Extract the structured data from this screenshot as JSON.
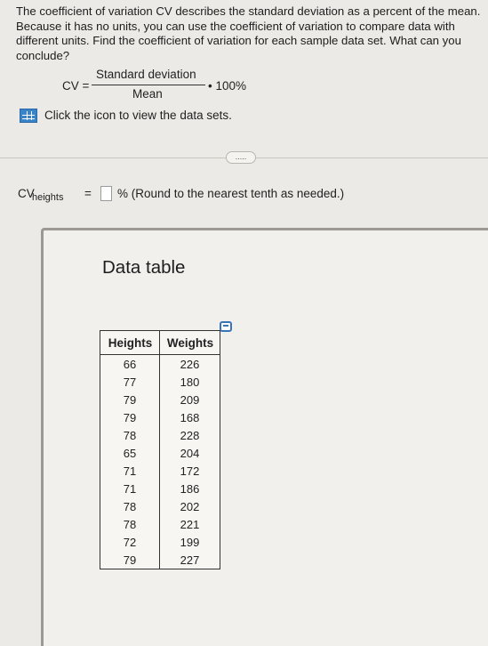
{
  "question": {
    "text": "The coefficient of variation CV describes the standard deviation as a percent of the mean. Because it has no units, you can use the coefficient of variation to compare data with different units. Find the coefficient of variation for each sample data set. What can you conclude?"
  },
  "formula": {
    "lhs": "CV =",
    "numerator": "Standard deviation",
    "denominator": "Mean",
    "multiplier": "• 100%"
  },
  "data_link": {
    "icon": "table-grid-icon",
    "label": "Click the icon to view the data sets."
  },
  "expand_button": {
    "label": "....."
  },
  "answer": {
    "cv_label": "CV",
    "cv_subscript": "heights",
    "equals": "=",
    "value": "",
    "hint": "% (Round to the nearest tenth as needed.)"
  },
  "data_table": {
    "title": "Data table",
    "copy_icon": "copy-icon",
    "columns": [
      "Heights",
      "Weights"
    ],
    "rows": [
      [
        "66",
        "226"
      ],
      [
        "77",
        "180"
      ],
      [
        "79",
        "209"
      ],
      [
        "79",
        "168"
      ],
      [
        "78",
        "228"
      ],
      [
        "65",
        "204"
      ],
      [
        "71",
        "172"
      ],
      [
        "71",
        "186"
      ],
      [
        "78",
        "202"
      ],
      [
        "78",
        "221"
      ],
      [
        "72",
        "199"
      ],
      [
        "79",
        "227"
      ]
    ]
  }
}
